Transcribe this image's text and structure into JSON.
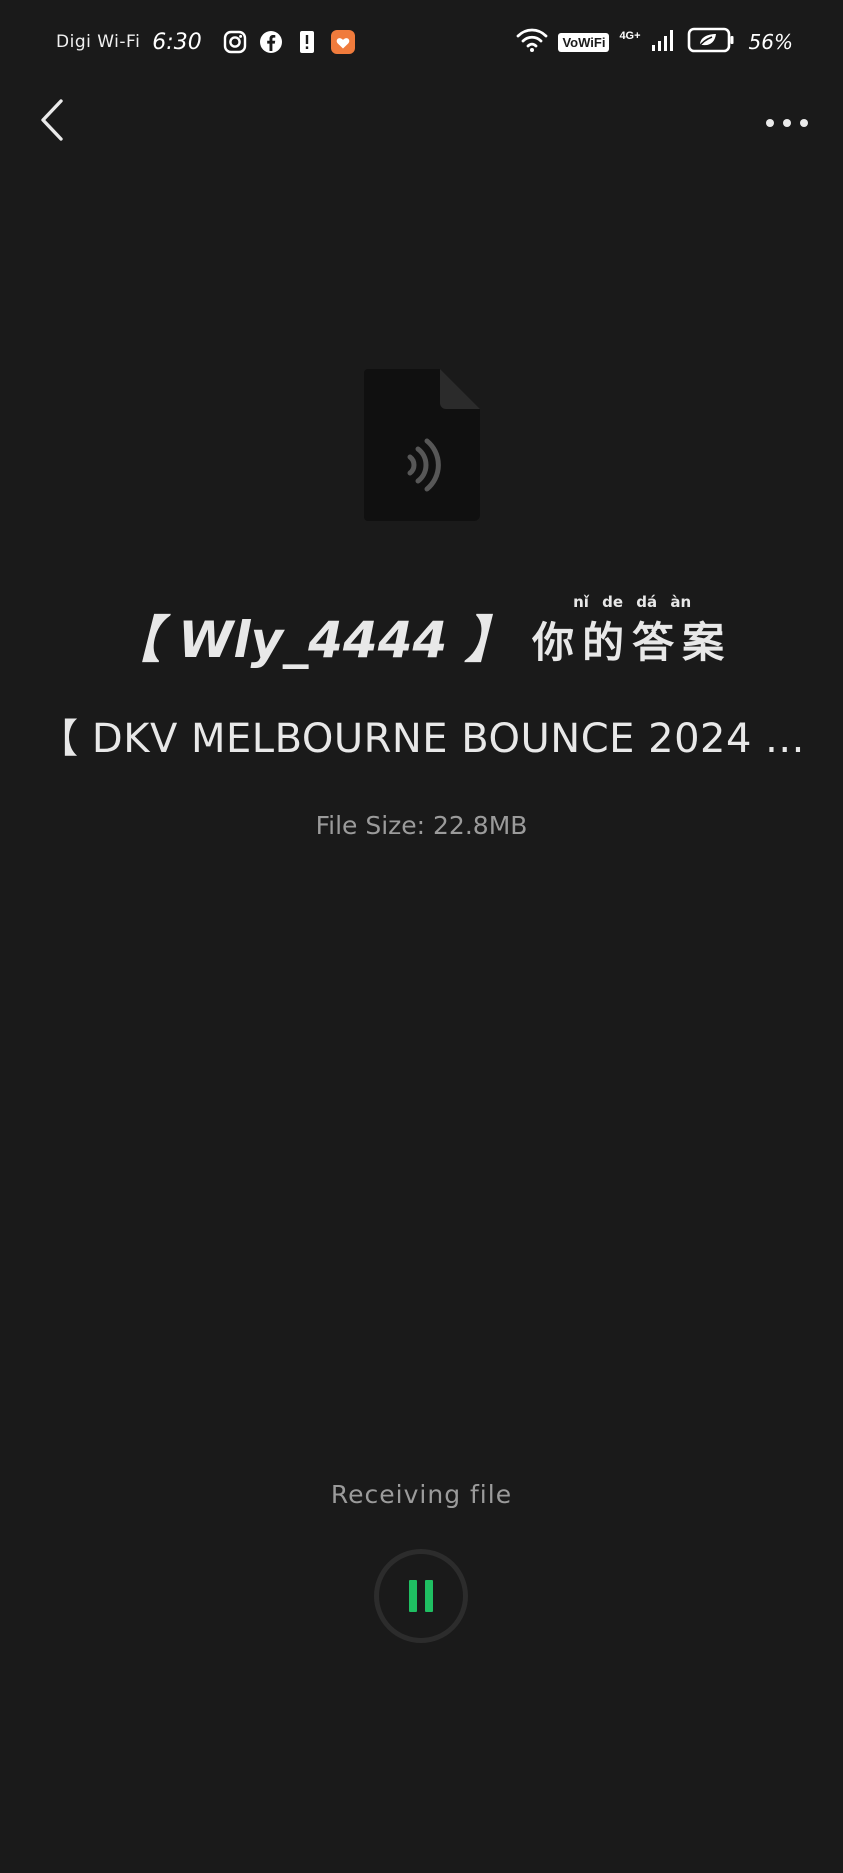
{
  "status_bar": {
    "carrier": "Digi Wi-Fi",
    "time": "6:30",
    "vowifi_label": "VoWiFi",
    "network_label": "4G+",
    "battery_percent": "56%",
    "app_icons": [
      "instagram-icon",
      "facebook-icon",
      "alert-icon",
      "shopee-icon"
    ]
  },
  "nav": {
    "back_icon": "chevron-left-icon",
    "more_icon": "more-horizontal-icon"
  },
  "file": {
    "icon": "audio-file-icon",
    "title_line_1_prefix": "【 Wly_4444 】",
    "title_line_1_cjk": "你的答案",
    "title_line_1_pinyin": "nǐ de dá àn",
    "title_line_2": "【 DKV MELBOURNE BOUNCE 2024 ...",
    "size_text": "File Size: 22.8MB"
  },
  "transfer": {
    "status_text": "Receiving file",
    "pause_icon": "pause-icon",
    "accent_color": "#1fbf62"
  }
}
